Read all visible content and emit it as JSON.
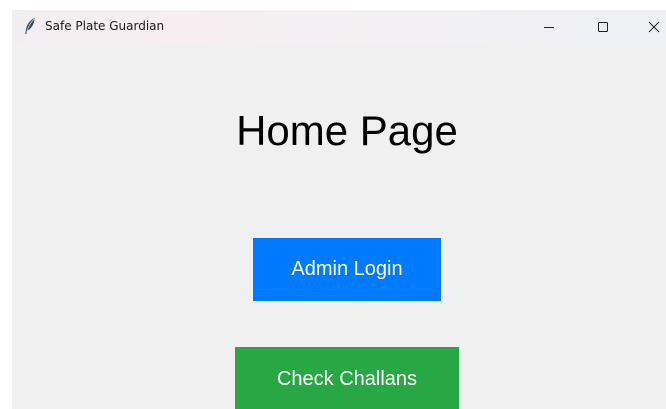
{
  "window": {
    "title": "Safe Plate Guardian",
    "icon": "feather-icon",
    "controls": {
      "minimize_icon": "minimize-icon",
      "maximize_icon": "maximize-icon",
      "close_icon": "close-icon"
    }
  },
  "main": {
    "heading": "Home Page",
    "buttons": [
      {
        "label": "Admin Login",
        "color": "#007bff"
      },
      {
        "label": "Check Challans",
        "color": "#28a745"
      }
    ]
  },
  "colors": {
    "background": "#f0f0f0",
    "primary": "#007bff",
    "success": "#28a745"
  }
}
